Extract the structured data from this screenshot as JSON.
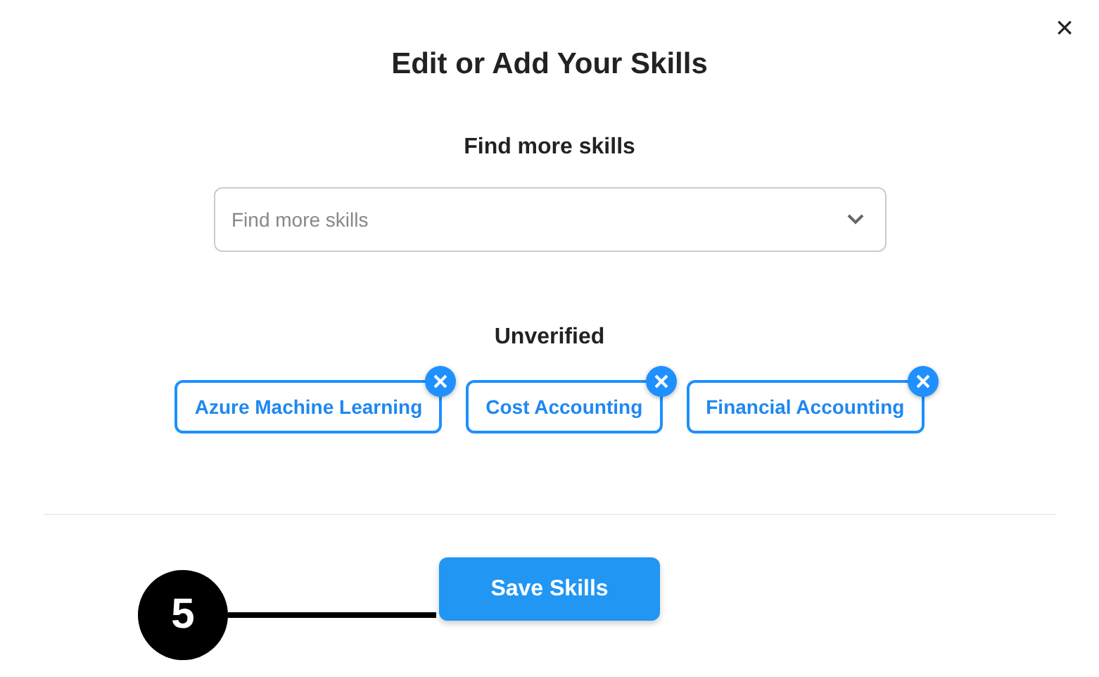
{
  "dialog": {
    "title": "Edit or Add Your Skills",
    "close": "×"
  },
  "search": {
    "label": "Find more skills",
    "placeholder": "Find more skills"
  },
  "unverified": {
    "heading": "Unverified",
    "skills": [
      {
        "label": "Azure Machine Learning"
      },
      {
        "label": "Cost Accounting"
      },
      {
        "label": "Financial Accounting"
      }
    ]
  },
  "save_button": "Save Skills",
  "callout": {
    "number": "5"
  }
}
